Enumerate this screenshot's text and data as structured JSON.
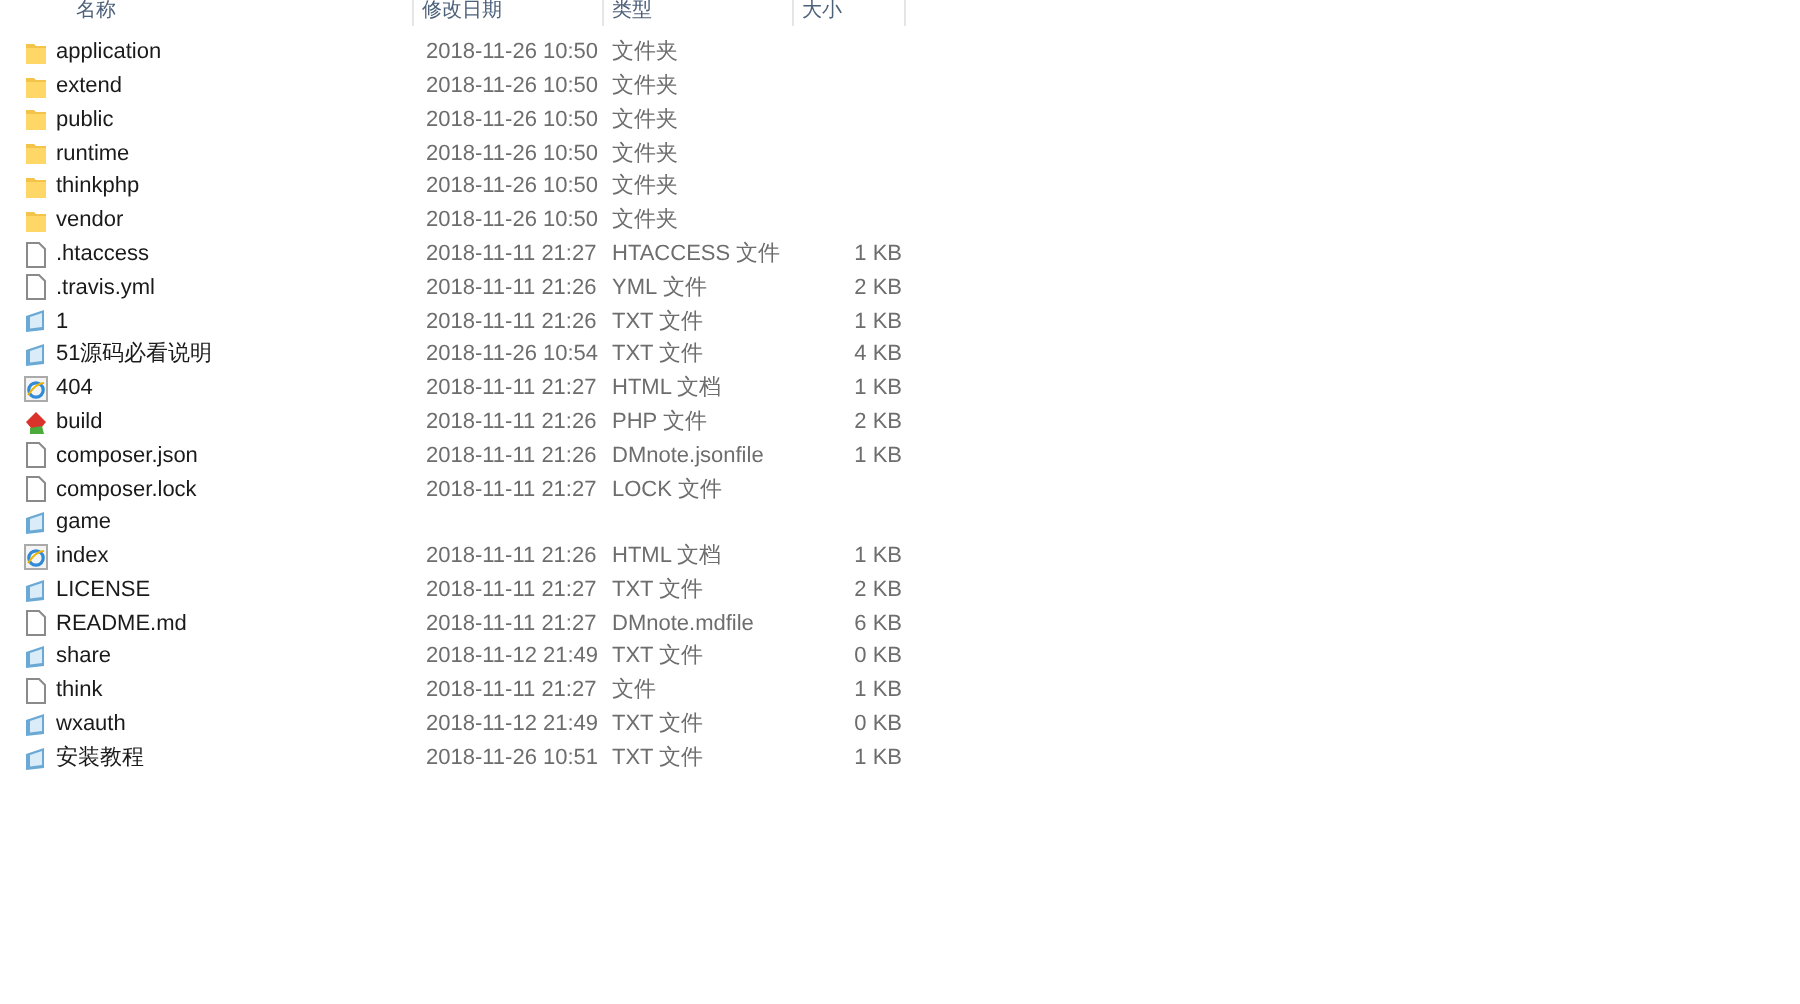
{
  "columns": [
    "名称",
    "修改日期",
    "类型",
    "大小"
  ],
  "files": [
    {
      "kind": "folder",
      "name": "application",
      "date": "2018-11-26 10:50",
      "type": "文件夹"
    },
    {
      "kind": "folder",
      "name": "extend",
      "date": "2018-11-26 10:50",
      "type": "文件夹"
    },
    {
      "kind": "folder",
      "name": "public",
      "date": "2018-11-26 10:50",
      "type": "文件夹"
    },
    {
      "kind": "folder",
      "name": "runtime",
      "date": "2018-11-26 10:50",
      "type": "文件夹"
    },
    {
      "kind": "folder",
      "name": "thinkphp",
      "date": "2018-11-26 10:50",
      "type": "文件夹"
    },
    {
      "kind": "folder",
      "name": "vendor",
      "date": "2018-11-26 10:50",
      "type": "文件夹"
    },
    {
      "kind": "file",
      "name": ".htaccess",
      "date": "2018-11-11 21:27",
      "type": "HTACCESS 文件",
      "size": "1 KB"
    },
    {
      "kind": "file",
      "name": ".travis.yml",
      "date": "2018-11-11 21:26",
      "type": "YML 文件",
      "size": "2 KB"
    },
    {
      "kind": "txt",
      "name": "1",
      "date": "2018-11-11 21:26",
      "type": "TXT 文件",
      "size": "1 KB"
    },
    {
      "kind": "txt",
      "name": "51源码必看说明",
      "date": "2018-11-26 10:54",
      "type": "TXT 文件",
      "size": "4 KB"
    },
    {
      "kind": "html",
      "name": "404",
      "date": "2018-11-11 21:27",
      "type": "HTML 文档",
      "size": "1 KB"
    },
    {
      "kind": "php",
      "name": "build",
      "date": "2018-11-11 21:26",
      "type": "PHP 文件",
      "size": "2 KB"
    },
    {
      "kind": "file",
      "name": "composer.json",
      "date": "2018-11-11 21:26",
      "type": "DMnote.jsonfile",
      "size": "1 KB"
    },
    {
      "kind": "file",
      "name": "composer.lock",
      "date": "2018-11-11 21:27",
      "type": "LOCK 文件"
    },
    {
      "kind": "txt",
      "name": "game"
    },
    {
      "kind": "html",
      "name": "index",
      "date": "2018-11-11 21:26",
      "type": "HTML 文档",
      "size": "1 KB"
    },
    {
      "kind": "txt",
      "name": "LICENSE",
      "date": "2018-11-11 21:27",
      "type": "TXT 文件",
      "size": "2 KB"
    },
    {
      "kind": "file",
      "name": "README.md",
      "date": "2018-11-11 21:27",
      "type": "DMnote.mdfile",
      "size": "6 KB"
    },
    {
      "kind": "txt",
      "name": "share",
      "date": "2018-11-12 21:49",
      "type": "TXT 文件",
      "size": "0 KB"
    },
    {
      "kind": "file",
      "name": "think",
      "date": "2018-11-11 21:27",
      "type": "文件",
      "size": "1 KB"
    },
    {
      "kind": "txt",
      "name": "wxauth",
      "date": "2018-11-12 21:49",
      "type": "TXT 文件",
      "size": "0 KB"
    },
    {
      "kind": "txt",
      "name": "安装教程",
      "date": "2018-11-26 10:51",
      "type": "TXT 文件",
      "size": "1 KB"
    }
  ]
}
